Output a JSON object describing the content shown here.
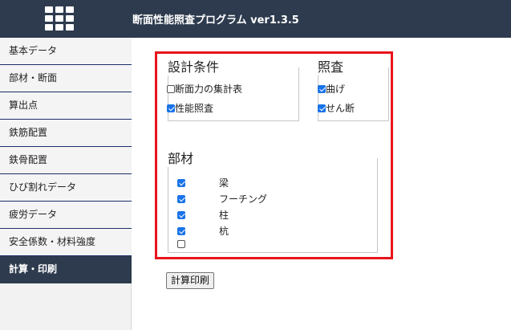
{
  "header": {
    "title": "断面性能照査プログラム ver1.3.5",
    "background": "#2e3b4e"
  },
  "sidebar": {
    "items": [
      {
        "label": "基本データ",
        "active": false
      },
      {
        "label": "部材・断面",
        "active": false
      },
      {
        "label": "算出点",
        "active": false
      },
      {
        "label": "鉄筋配置",
        "active": false
      },
      {
        "label": "鉄骨配置",
        "active": false
      },
      {
        "label": "ひび割れデータ",
        "active": false
      },
      {
        "label": "疲労データ",
        "active": false
      },
      {
        "label": "安全係数・材料強度",
        "active": false
      },
      {
        "label": "計算・印刷",
        "active": true
      }
    ]
  },
  "design_conditions": {
    "title": "設計条件",
    "options": [
      {
        "label": "断面力の集計表",
        "checked": false
      },
      {
        "label": "性能照査",
        "checked": true
      }
    ]
  },
  "verification": {
    "title": "照査",
    "options": [
      {
        "label": "曲げ",
        "checked": true
      },
      {
        "label": "せん断",
        "checked": true
      }
    ]
  },
  "members": {
    "title": "部材",
    "options": [
      {
        "label": "梁",
        "checked": true
      },
      {
        "label": "フーチング",
        "checked": true
      },
      {
        "label": "柱",
        "checked": true
      },
      {
        "label": "杭",
        "checked": true
      },
      {
        "label": "",
        "checked": false
      }
    ]
  },
  "actions": {
    "print_label": "計算印刷"
  },
  "colors": {
    "highlight_frame": "#e8141b",
    "checkbox_checked": "#1a73e8"
  }
}
